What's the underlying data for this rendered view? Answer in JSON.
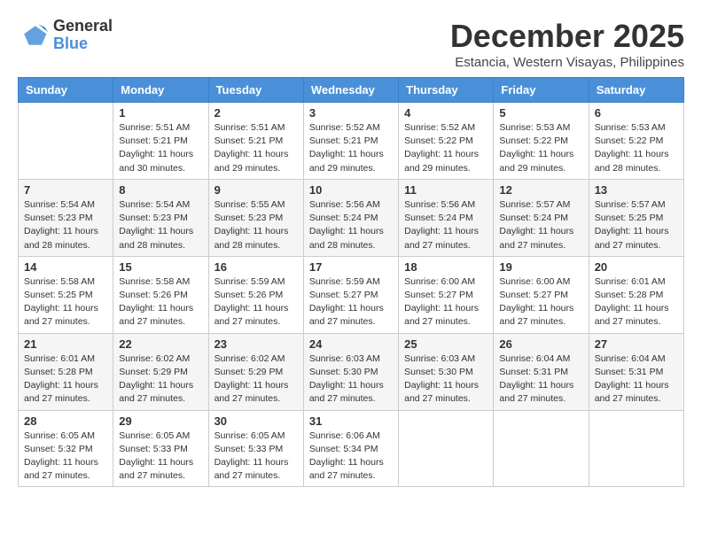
{
  "logo": {
    "general": "General",
    "blue": "Blue"
  },
  "title": "December 2025",
  "subtitle": "Estancia, Western Visayas, Philippines",
  "weekdays": [
    "Sunday",
    "Monday",
    "Tuesday",
    "Wednesday",
    "Thursday",
    "Friday",
    "Saturday"
  ],
  "weeks": [
    [
      {
        "day": "",
        "info": ""
      },
      {
        "day": "1",
        "info": "Sunrise: 5:51 AM\nSunset: 5:21 PM\nDaylight: 11 hours\nand 30 minutes."
      },
      {
        "day": "2",
        "info": "Sunrise: 5:51 AM\nSunset: 5:21 PM\nDaylight: 11 hours\nand 29 minutes."
      },
      {
        "day": "3",
        "info": "Sunrise: 5:52 AM\nSunset: 5:21 PM\nDaylight: 11 hours\nand 29 minutes."
      },
      {
        "day": "4",
        "info": "Sunrise: 5:52 AM\nSunset: 5:22 PM\nDaylight: 11 hours\nand 29 minutes."
      },
      {
        "day": "5",
        "info": "Sunrise: 5:53 AM\nSunset: 5:22 PM\nDaylight: 11 hours\nand 29 minutes."
      },
      {
        "day": "6",
        "info": "Sunrise: 5:53 AM\nSunset: 5:22 PM\nDaylight: 11 hours\nand 28 minutes."
      }
    ],
    [
      {
        "day": "7",
        "info": "Sunrise: 5:54 AM\nSunset: 5:23 PM\nDaylight: 11 hours\nand 28 minutes."
      },
      {
        "day": "8",
        "info": "Sunrise: 5:54 AM\nSunset: 5:23 PM\nDaylight: 11 hours\nand 28 minutes."
      },
      {
        "day": "9",
        "info": "Sunrise: 5:55 AM\nSunset: 5:23 PM\nDaylight: 11 hours\nand 28 minutes."
      },
      {
        "day": "10",
        "info": "Sunrise: 5:56 AM\nSunset: 5:24 PM\nDaylight: 11 hours\nand 28 minutes."
      },
      {
        "day": "11",
        "info": "Sunrise: 5:56 AM\nSunset: 5:24 PM\nDaylight: 11 hours\nand 27 minutes."
      },
      {
        "day": "12",
        "info": "Sunrise: 5:57 AM\nSunset: 5:24 PM\nDaylight: 11 hours\nand 27 minutes."
      },
      {
        "day": "13",
        "info": "Sunrise: 5:57 AM\nSunset: 5:25 PM\nDaylight: 11 hours\nand 27 minutes."
      }
    ],
    [
      {
        "day": "14",
        "info": "Sunrise: 5:58 AM\nSunset: 5:25 PM\nDaylight: 11 hours\nand 27 minutes."
      },
      {
        "day": "15",
        "info": "Sunrise: 5:58 AM\nSunset: 5:26 PM\nDaylight: 11 hours\nand 27 minutes."
      },
      {
        "day": "16",
        "info": "Sunrise: 5:59 AM\nSunset: 5:26 PM\nDaylight: 11 hours\nand 27 minutes."
      },
      {
        "day": "17",
        "info": "Sunrise: 5:59 AM\nSunset: 5:27 PM\nDaylight: 11 hours\nand 27 minutes."
      },
      {
        "day": "18",
        "info": "Sunrise: 6:00 AM\nSunset: 5:27 PM\nDaylight: 11 hours\nand 27 minutes."
      },
      {
        "day": "19",
        "info": "Sunrise: 6:00 AM\nSunset: 5:27 PM\nDaylight: 11 hours\nand 27 minutes."
      },
      {
        "day": "20",
        "info": "Sunrise: 6:01 AM\nSunset: 5:28 PM\nDaylight: 11 hours\nand 27 minutes."
      }
    ],
    [
      {
        "day": "21",
        "info": "Sunrise: 6:01 AM\nSunset: 5:28 PM\nDaylight: 11 hours\nand 27 minutes."
      },
      {
        "day": "22",
        "info": "Sunrise: 6:02 AM\nSunset: 5:29 PM\nDaylight: 11 hours\nand 27 minutes."
      },
      {
        "day": "23",
        "info": "Sunrise: 6:02 AM\nSunset: 5:29 PM\nDaylight: 11 hours\nand 27 minutes."
      },
      {
        "day": "24",
        "info": "Sunrise: 6:03 AM\nSunset: 5:30 PM\nDaylight: 11 hours\nand 27 minutes."
      },
      {
        "day": "25",
        "info": "Sunrise: 6:03 AM\nSunset: 5:30 PM\nDaylight: 11 hours\nand 27 minutes."
      },
      {
        "day": "26",
        "info": "Sunrise: 6:04 AM\nSunset: 5:31 PM\nDaylight: 11 hours\nand 27 minutes."
      },
      {
        "day": "27",
        "info": "Sunrise: 6:04 AM\nSunset: 5:31 PM\nDaylight: 11 hours\nand 27 minutes."
      }
    ],
    [
      {
        "day": "28",
        "info": "Sunrise: 6:05 AM\nSunset: 5:32 PM\nDaylight: 11 hours\nand 27 minutes."
      },
      {
        "day": "29",
        "info": "Sunrise: 6:05 AM\nSunset: 5:33 PM\nDaylight: 11 hours\nand 27 minutes."
      },
      {
        "day": "30",
        "info": "Sunrise: 6:05 AM\nSunset: 5:33 PM\nDaylight: 11 hours\nand 27 minutes."
      },
      {
        "day": "31",
        "info": "Sunrise: 6:06 AM\nSunset: 5:34 PM\nDaylight: 11 hours\nand 27 minutes."
      },
      {
        "day": "",
        "info": ""
      },
      {
        "day": "",
        "info": ""
      },
      {
        "day": "",
        "info": ""
      }
    ]
  ]
}
